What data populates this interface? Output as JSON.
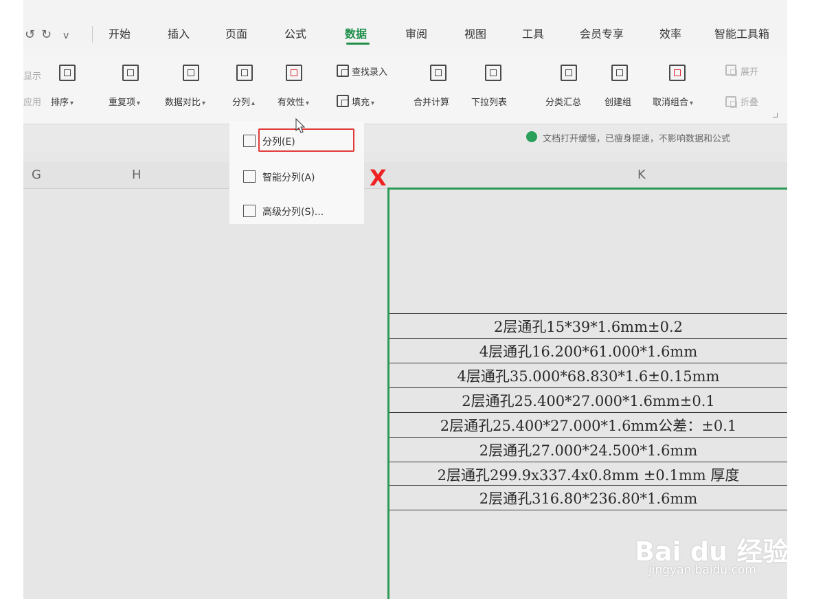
{
  "quick_access": {
    "undo_icon": "undo-icon",
    "redo_icon": "redo-icon",
    "more_icon": "chevron-down-icon",
    "undo": "↺",
    "redo": "↻",
    "more": "v"
  },
  "tabs": [
    {
      "label": "开始"
    },
    {
      "label": "插入"
    },
    {
      "label": "页面"
    },
    {
      "label": "公式"
    },
    {
      "label": "数据",
      "active": true
    },
    {
      "label": "审阅"
    },
    {
      "label": "视图"
    },
    {
      "label": "工具"
    },
    {
      "label": "会员专享"
    },
    {
      "label": "效率"
    },
    {
      "label": "智能工具箱"
    }
  ],
  "ribbon": {
    "left_partial_top": "显示",
    "left_partial_bottom": "应用",
    "sort": "排序",
    "duplicates": "重复项",
    "compare": "数据对比",
    "split": "分列",
    "validity": "有效性",
    "find_entry": "查找录入",
    "fill": "填充",
    "consolidate": "合并计算",
    "dropdown_list": "下拉列表",
    "subtotal": "分类汇总",
    "create_group": "创建组",
    "ungroup": "取消组合",
    "expand": "展开",
    "collapse": "折叠"
  },
  "notice": "文档打开缓慢，已瘦身提速，不影响数据和公式",
  "columns": [
    "G",
    "H",
    "K"
  ],
  "split_menu": {
    "items": [
      {
        "label": "分列(E)",
        "icon": "split-columns-icon"
      },
      {
        "label": "智能分列(A)",
        "icon": "smart-split-icon"
      },
      {
        "label": "高级分列(S)...",
        "icon": "advanced-split-icon"
      }
    ],
    "red_x": "X"
  },
  "cells": [
    "2层通孔15*39*1.6mm±0.2",
    "4层通孔16.200*61.000*1.6mm",
    "4层通孔35.000*68.830*1.6±0.15mm",
    "2层通孔25.400*27.000*1.6mm±0.1",
    "2层通孔25.400*27.000*1.6mm公差：±0.1",
    "2层通孔27.000*24.500*1.6mm",
    "2层通孔299.9x337.4x0.8mm ±0.1mm 厚度",
    "2层通孔316.80*236.80*1.6mm"
  ],
  "watermark": {
    "logo": "Bai du 经验",
    "url": "jingyan.baidu.com"
  },
  "colors": {
    "accent": "#1f8f4a",
    "selection": "#2a9a55",
    "annotation": "#e23a3a"
  }
}
